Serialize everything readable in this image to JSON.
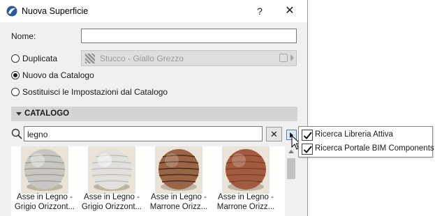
{
  "window": {
    "title": "Nuova Superficie",
    "help_label": "?",
    "close_label": "✕"
  },
  "form": {
    "name_label": "Nome:",
    "name_value": "",
    "option_duplicate": "Duplicata",
    "duplicate_surface": "Stucco - Giallo Grezzo",
    "option_new_from_catalog": "Nuovo da Catalogo",
    "option_replace_settings": "Sostituisci le Impostazioni dal Catalogo",
    "selected_option": "Nuovo da Catalogo"
  },
  "catalog": {
    "title": "CATALOGO",
    "search_value": "legno",
    "clear_label": "✕",
    "items": [
      {
        "line1": "Asse in Legno -",
        "line2": "Grigio Orizzont...",
        "swatch": "grey-light"
      },
      {
        "line1": "Asse in Legno -",
        "line2": "Grigio Orizzont...",
        "swatch": "grey-white"
      },
      {
        "line1": "Asse in Legno -",
        "line2": "Marrone Orizz...",
        "swatch": "brown"
      },
      {
        "line1": "Asse in Legno -",
        "line2": "Marrone Orizz...",
        "swatch": "brown-red"
      }
    ]
  },
  "search_menu": {
    "items": [
      {
        "label": "Ricerca Libreria Attiva",
        "checked": true
      },
      {
        "label": "Ricerca Portale BIM Components",
        "checked": true
      }
    ]
  },
  "colors": {
    "dialog_bg": "#f0f0f0",
    "accent_blue": "#2b5b9a"
  }
}
